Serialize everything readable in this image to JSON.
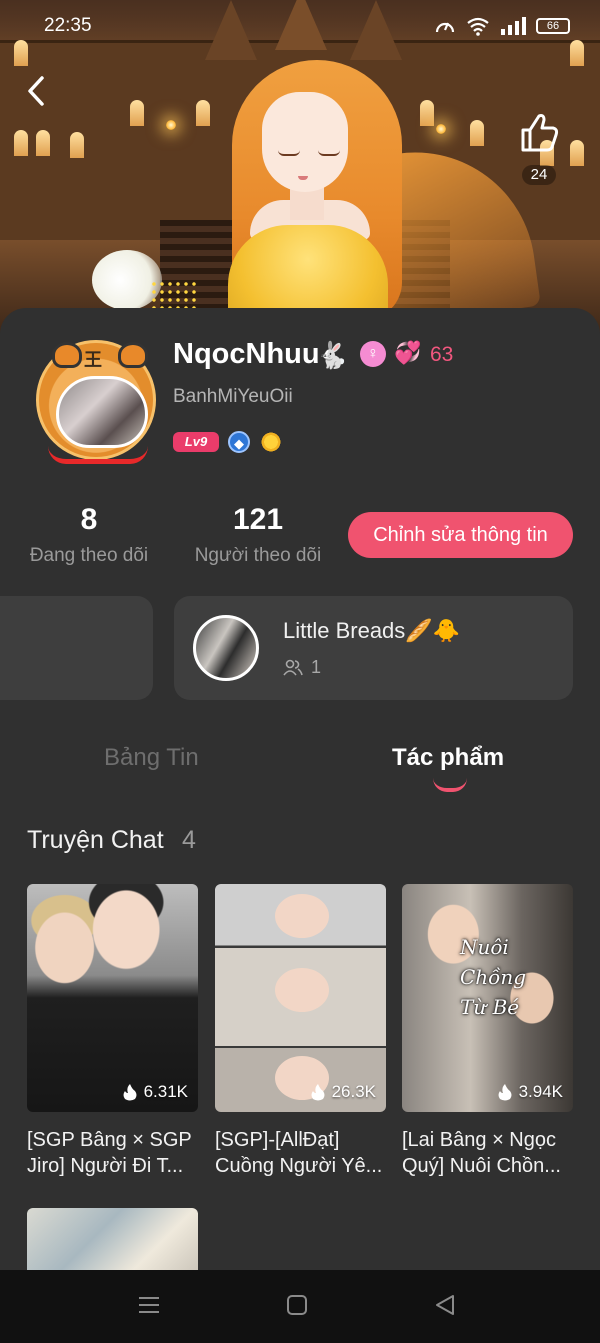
{
  "status_bar": {
    "time": "22:35",
    "battery": "66"
  },
  "header": {
    "like_count": "24"
  },
  "profile": {
    "display_name": "NqocNhuu",
    "name_emoji": "🐇",
    "gender_symbol": "♀",
    "heart_emoji": "💞",
    "heart_count": "63",
    "handle": "BanhMiYeuOii",
    "level_badge": "Lv9",
    "tiger_mark": "王"
  },
  "stats": {
    "following_count": "8",
    "following_label": "Đang theo dõi",
    "followers_count": "121",
    "followers_label": "Người theo dõi",
    "edit_button": "Chỉnh sửa thông tin"
  },
  "group": {
    "name": "Little Breads🥖🐥",
    "members": "1"
  },
  "tabs": [
    {
      "label": "Bảng Tin",
      "active": false
    },
    {
      "label": "Tác phẩm",
      "active": true
    }
  ],
  "section": {
    "title": "Truyện Chat",
    "count": "4"
  },
  "stories": [
    {
      "title": "[SGP Bâng × SGP Jiro] Người Đi T...",
      "views": "6.31K"
    },
    {
      "title": "[SGP]-[AllĐạt] Cuồng Người Yê...",
      "views": "26.3K"
    },
    {
      "title": "[Lai Bâng × Ngọc Quý] Nuôi Chồn...",
      "views": "3.94K",
      "cover_text": "Nuôi Chồng Từ Bé"
    }
  ],
  "colors": {
    "accent": "#f0536f",
    "background": "#303030",
    "card": "#3e3e3e",
    "muted": "#9a9a9a"
  }
}
